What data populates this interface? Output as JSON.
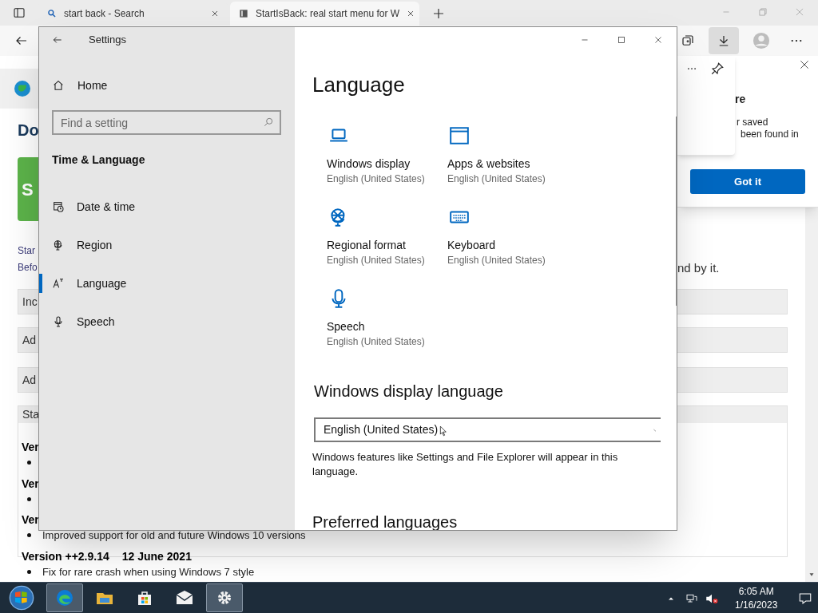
{
  "browser": {
    "tabs": [
      {
        "title": "start back - Search",
        "kind": "search",
        "selected": false
      },
      {
        "title": "StartIsBack: real start menu for W",
        "kind": "page",
        "selected": true
      }
    ]
  },
  "popup": {
    "heading": "re",
    "lines": [
      "r saved",
      "been found in"
    ],
    "button": "Got it"
  },
  "page": {
    "heading": "Do",
    "button": "S",
    "intro": [
      "Star",
      "Befo"
    ],
    "intro_tail": "nd by it.",
    "sections": [
      "Inc",
      "Ad",
      "Ad"
    ],
    "panel": {
      "header": "Sta",
      "versions": [
        {
          "title": "Ver"
        },
        {
          "title": "Ver"
        },
        {
          "title": "Ver",
          "bullet": "Improved support for old and future Windows 10 versions"
        },
        {
          "title": "Version ++2.9.14",
          "date": "12 June 2021",
          "bullet": "Fix for rare crash when using Windows 7 style"
        }
      ]
    }
  },
  "settings": {
    "title": "Settings",
    "home": "Home",
    "search_placeholder": "Find a setting",
    "section": "Time & Language",
    "nav": [
      {
        "label": "Date & time",
        "kind": "date",
        "selected": false
      },
      {
        "label": "Region",
        "kind": "region",
        "selected": false
      },
      {
        "label": "Language",
        "kind": "language",
        "selected": true
      },
      {
        "label": "Speech",
        "kind": "speech",
        "selected": false
      }
    ],
    "page_title": "Language",
    "tiles": [
      {
        "title": "Windows display",
        "value": "English (United States)",
        "kind": "display"
      },
      {
        "title": "Apps & websites",
        "value": "English (United States)",
        "kind": "apps"
      },
      {
        "title": "Regional format",
        "value": "English (United States)",
        "kind": "region"
      },
      {
        "title": "Keyboard",
        "value": "English (United States)",
        "kind": "keyboard"
      },
      {
        "title": "Speech",
        "value": "English (United States)",
        "kind": "speech"
      }
    ],
    "display_language": {
      "heading": "Windows display language",
      "value": "English (United States)",
      "description": "Windows features like Settings and File Explorer will appear in this language."
    },
    "next_heading": "Preferred languages"
  },
  "taskbar": {
    "apps": [
      {
        "kind": "edge",
        "active": true
      },
      {
        "kind": "explorer",
        "active": false
      },
      {
        "kind": "store",
        "active": false
      },
      {
        "kind": "mail",
        "active": false
      },
      {
        "kind": "settings",
        "active": true
      }
    ],
    "clock": {
      "time": "6:05 AM",
      "date": "1/16/2023"
    }
  }
}
